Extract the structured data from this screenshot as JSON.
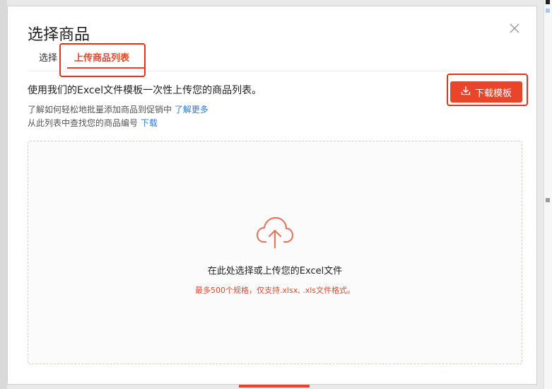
{
  "modal": {
    "title": "选择商品"
  },
  "tabs": [
    {
      "label": "选择"
    },
    {
      "label": "上传商品列表"
    }
  ],
  "description": "使用我们的Excel文件模板一次性上传您的商品列表。",
  "help": {
    "line1_text": "了解如何轻松地批量添加商品到促销中 ",
    "line1_link": "了解更多",
    "line2_text": "从此列表中查找您的商品编号 ",
    "line2_link": "下载"
  },
  "download_button": {
    "label": "下载模板",
    "icon": "download-icon"
  },
  "dropzone": {
    "icon": "cloud-upload-icon",
    "title": "在此处选择或上传您的Excel文件",
    "subtitle": "最多500个规格，仅支持.xlsx, .xls文件格式。"
  },
  "colors": {
    "accent": "#e8452b",
    "link": "#2a7bd6",
    "highlight": "#e8301c"
  }
}
